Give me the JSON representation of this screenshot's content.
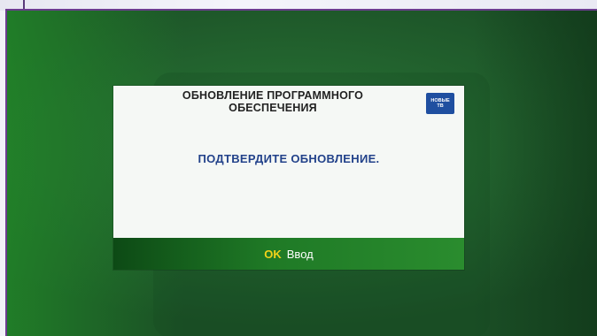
{
  "dialog": {
    "title_line1": "ОБНОВЛЕНИЕ ПРОГРАММНОГО",
    "title_line2": "ОБЕСПЕЧЕНИЯ",
    "message": "ПОДТВЕРДИТЕ ОБНОВЛЕНИЕ.",
    "logo_line1": "НОВЫЕ",
    "logo_line2": "ТВ",
    "footer": {
      "key": "OK",
      "action": "Ввод"
    }
  },
  "colors": {
    "background_green": "#23652f",
    "dialog_bg": "#f5f8f5",
    "message_blue": "#22428a",
    "ok_yellow": "#f2d21a",
    "footer_green": "#1f7a26",
    "logo_blue": "#1f4fa0"
  }
}
